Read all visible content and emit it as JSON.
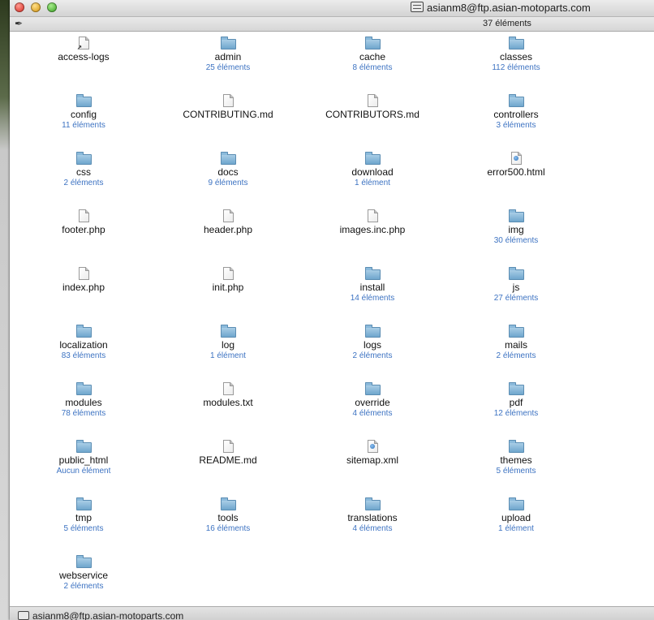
{
  "window": {
    "title": "asianm8@ftp.asian-motoparts.com",
    "item_count": "37 éléments",
    "status_path": "asianm8@ftp.asian-motoparts.com"
  },
  "items": [
    {
      "name": "access-logs",
      "type": "alias",
      "sub": ""
    },
    {
      "name": "admin",
      "type": "folder",
      "sub": "25 éléments"
    },
    {
      "name": "cache",
      "type": "folder",
      "sub": "8 éléments"
    },
    {
      "name": "classes",
      "type": "folder",
      "sub": "112 éléments"
    },
    {
      "name": "config",
      "type": "folder",
      "sub": "11 éléments"
    },
    {
      "name": "CONTRIBUTING.md",
      "type": "file",
      "sub": ""
    },
    {
      "name": "CONTRIBUTORS.md",
      "type": "file",
      "sub": ""
    },
    {
      "name": "controllers",
      "type": "folder",
      "sub": "3 éléments"
    },
    {
      "name": "css",
      "type": "folder",
      "sub": "2 éléments"
    },
    {
      "name": "docs",
      "type": "folder",
      "sub": "9 éléments"
    },
    {
      "name": "download",
      "type": "folder",
      "sub": "1 élément"
    },
    {
      "name": "error500.html",
      "type": "web",
      "sub": ""
    },
    {
      "name": "footer.php",
      "type": "file",
      "sub": ""
    },
    {
      "name": "header.php",
      "type": "file",
      "sub": ""
    },
    {
      "name": "images.inc.php",
      "type": "file",
      "sub": ""
    },
    {
      "name": "img",
      "type": "folder",
      "sub": "30 éléments"
    },
    {
      "name": "index.php",
      "type": "file",
      "sub": ""
    },
    {
      "name": "init.php",
      "type": "file",
      "sub": ""
    },
    {
      "name": "install",
      "type": "folder",
      "sub": "14 éléments"
    },
    {
      "name": "js",
      "type": "folder",
      "sub": "27 éléments"
    },
    {
      "name": "localization",
      "type": "folder",
      "sub": "83 éléments"
    },
    {
      "name": "log",
      "type": "folder",
      "sub": "1 élément"
    },
    {
      "name": "logs",
      "type": "folder",
      "sub": "2 éléments"
    },
    {
      "name": "mails",
      "type": "folder",
      "sub": "2 éléments"
    },
    {
      "name": "modules",
      "type": "folder",
      "sub": "78 éléments"
    },
    {
      "name": "modules.txt",
      "type": "file",
      "sub": ""
    },
    {
      "name": "override",
      "type": "folder",
      "sub": "4 éléments"
    },
    {
      "name": "pdf",
      "type": "folder",
      "sub": "12 éléments"
    },
    {
      "name": "public_html",
      "type": "folder",
      "sub": "Aucun élément"
    },
    {
      "name": "README.md",
      "type": "file",
      "sub": ""
    },
    {
      "name": "sitemap.xml",
      "type": "web",
      "sub": ""
    },
    {
      "name": "themes",
      "type": "folder",
      "sub": "5 éléments"
    },
    {
      "name": "tmp",
      "type": "folder",
      "sub": "5 éléments"
    },
    {
      "name": "tools",
      "type": "folder",
      "sub": "16 éléments"
    },
    {
      "name": "translations",
      "type": "folder",
      "sub": "4 éléments"
    },
    {
      "name": "upload",
      "type": "folder",
      "sub": "1 élément"
    },
    {
      "name": "webservice",
      "type": "folder",
      "sub": "2 éléments"
    }
  ],
  "colors": {
    "subtext": "#3d73c2",
    "folder": "#7fb2d6"
  },
  "icons": {
    "folder": "folder-icon",
    "file": "document-icon",
    "alias": "alias-document-icon",
    "web": "web-document-icon",
    "toolbar": "pin-icon",
    "title": "network-drive-icon"
  }
}
